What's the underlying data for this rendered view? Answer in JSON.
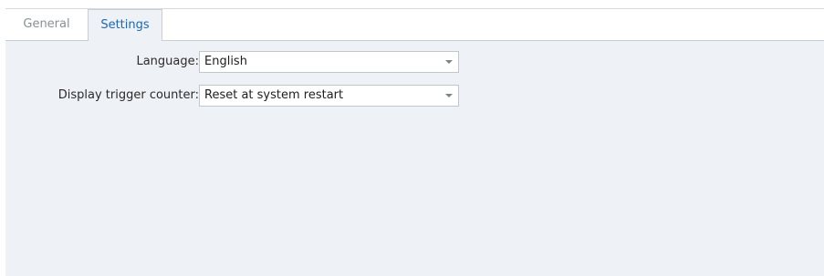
{
  "tabs": [
    {
      "label": "General",
      "active": false
    },
    {
      "label": "Settings",
      "active": true
    }
  ],
  "settings": {
    "language": {
      "label": "Language:",
      "value": "English"
    },
    "trigger_counter": {
      "label": "Display trigger counter:",
      "value": "Reset at system restart"
    }
  },
  "colors": {
    "panel_background": "#eef1f5",
    "active_tab_text": "#1f67b1",
    "inactive_tab_text": "#8a8f96",
    "border": "#c9ced4"
  },
  "icons": {
    "dropdown": "chevron-down-icon"
  }
}
